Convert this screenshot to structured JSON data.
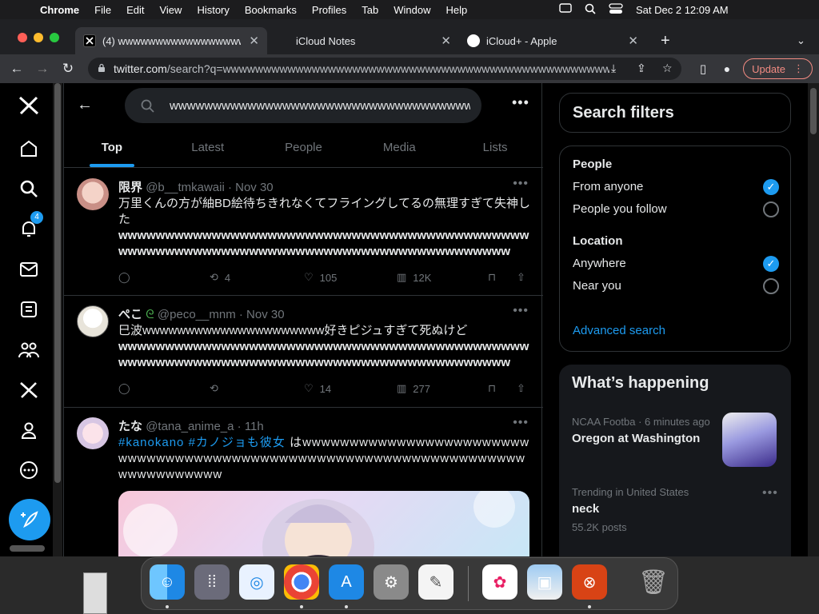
{
  "menubar": {
    "app": "Chrome",
    "items": [
      "File",
      "Edit",
      "View",
      "History",
      "Bookmarks",
      "Profiles",
      "Tab",
      "Window",
      "Help"
    ],
    "datetime": "Sat Dec 2  12:09 AM"
  },
  "tabs": [
    {
      "title": "(4) wwwwwwwwwwwwwwwwwwwwwww",
      "icon": "x-logo-icon"
    },
    {
      "title": "iCloud Notes",
      "icon": "apple-icon"
    },
    {
      "title": "iCloud+ - Apple",
      "icon": "apple-icon"
    }
  ],
  "toolbar": {
    "url_host": "twitter.com",
    "url_path": "/search?q=wwwwwwwwwwwwwwwwwwwwwwwwwwwwwwwwwwwwwwwwwwwwwwwwwwwwwwwwwwww...",
    "update_label": "Update"
  },
  "leftnav": {
    "notification_count": "4"
  },
  "search": {
    "value": "wwwwwwwwwwwwwwwwwwwwwwwwwwwwwwwwwwwwwwwwwwwwww",
    "tabs": [
      "Top",
      "Latest",
      "People",
      "Media",
      "Lists"
    ]
  },
  "tweets": [
    {
      "name": "限界",
      "handle": "@b__tmkawaii · Nov 30",
      "text_jp": "万里くんの方が紬BD絵待ちきれなくてフライングしてるの無理すぎて失神した",
      "text_w": "wwwwwwwwwwwwwwwwwwwwwwwwwwwwwwwwwwwwwwwwwwwwwwwwwwwwwwwwwwwwwwwwwwwwwwwwwwwwwwwwwwwwww",
      "replies": "",
      "retweets": "4",
      "likes": "105",
      "views": "12K"
    },
    {
      "name": "ぺこ",
      "handle": "@peco__mnm · Nov 30",
      "text_jp": "巳波wwwwwwwwwwwwwwwwwwwww好きピジュすぎて死ぬけど",
      "text_w": "wwwwwwwwwwwwwwwwwwwwwwwwwwwwwwwwwwwwwwwwwwwwwwwwwwwwwwwwwwwwwwwwwwwwwwwwwwwwwwwwwwwwww",
      "replies": "",
      "retweets": "",
      "likes": "14",
      "views": "277"
    },
    {
      "name": "たな",
      "handle": "@tana_anime_a · 11h",
      "hashtags": "#kanokano #カノジョも彼女",
      "text_w": "はwwwwwwwwwwwwwwwwwwwwwwwwwwwwwwwwwwwwwwwwwwwwwwwwwwwwwwwwwwwwwwwwwwwwwwwwwwwwww"
    }
  ],
  "filters": {
    "title": "Search filters",
    "people_heading": "People",
    "people_options": [
      "From anyone",
      "People you follow"
    ],
    "location_heading": "Location",
    "location_options": [
      "Anywhere",
      "Near you"
    ],
    "advanced": "Advanced search"
  },
  "happening": {
    "title": "What’s happening",
    "trend1_meta": "NCAA Footba · 6 minutes ago",
    "trend1_title": "Oregon at Washington",
    "trend2_meta": "Trending in United States",
    "trend2_title": "neck",
    "trend2_posts": "55.2K posts"
  },
  "colors": {
    "accent": "#1d9bf0",
    "background": "#000000",
    "border": "#2f3336",
    "muted": "#71767b"
  }
}
